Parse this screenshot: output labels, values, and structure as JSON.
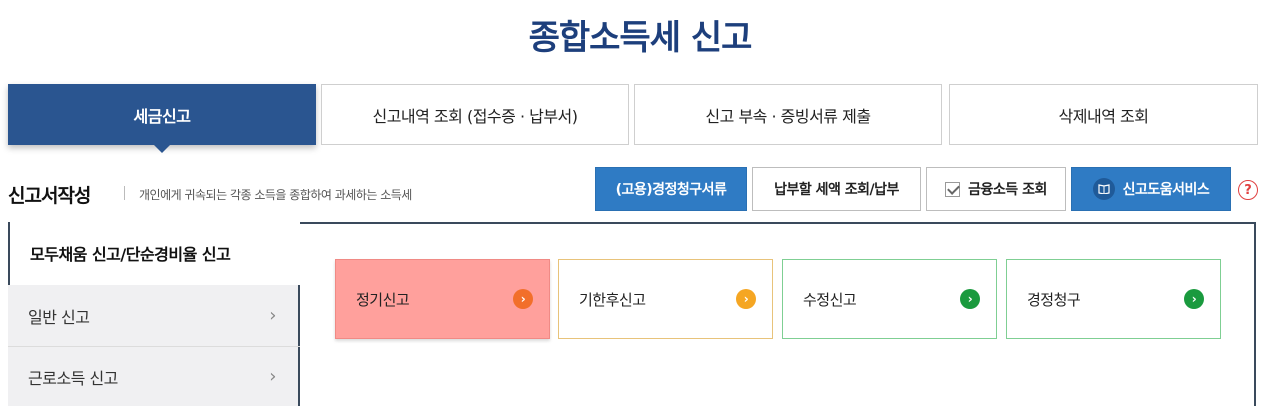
{
  "page": {
    "title": "종합소득세 신고"
  },
  "tabs": [
    {
      "label": "세금신고",
      "active": true
    },
    {
      "label": "신고내역 조회 (접수증 · 납부서)"
    },
    {
      "label": "신고 부속 · 증빙서류 제출"
    },
    {
      "label": "삭제내역 조회"
    }
  ],
  "section": {
    "title": "신고서작성",
    "description": "개인에게 귀속되는 각종 소득을 종합하여 과세하는 소득세"
  },
  "actions": {
    "claim_docs": "(고용)경정청구서류",
    "tax_payment": "납부할 세액 조회/납부",
    "financial_income": "금융소득 조회",
    "help_service": "신고도움서비스",
    "help_icon_glyph": "?"
  },
  "sidebar": {
    "items": [
      {
        "label": "모두채움 신고/단순경비율 신고",
        "active": true
      },
      {
        "label": "일반 신고"
      },
      {
        "label": "근로소득 신고"
      }
    ],
    "chevron": "›"
  },
  "cards": [
    {
      "label": "정기신고",
      "accent": "#f26f2a",
      "highlight": true
    },
    {
      "label": "기한후신고",
      "accent": "#f5a623",
      "border": "#e8c37a"
    },
    {
      "label": "수정신고",
      "accent": "#1a9a3e",
      "border": "#7fcf93"
    },
    {
      "label": "경정청구",
      "accent": "#1a9a3e",
      "border": "#7fcf93"
    }
  ],
  "colors": {
    "title": "#1d3f7c",
    "active_tab": "#2a5590",
    "action_blue": "#2f7bc4",
    "highlight_card_bg": "#ffa09c"
  }
}
